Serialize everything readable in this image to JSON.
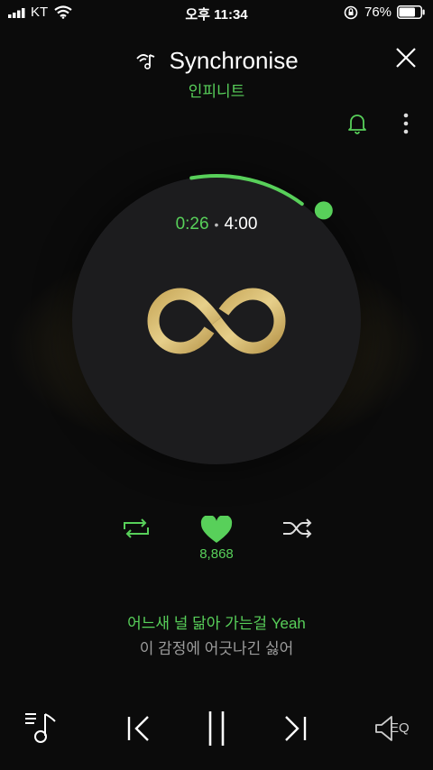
{
  "status_bar": {
    "carrier": "KT",
    "time": "오후 11:34",
    "battery_percent": "76%",
    "battery_level": 0.76
  },
  "header": {
    "song_title": "Synchronise",
    "artist": "인피니트",
    "close_icon": "close-icon",
    "alarm_icon": "bell-icon",
    "more_icon": "more-vertical-icon"
  },
  "player": {
    "current_time": "0:26",
    "separator": "•",
    "total_time": "4:00",
    "progress": 0.108,
    "accent_color": "#58d05a",
    "logo_color": "#d9bd6e"
  },
  "controls": {
    "repeat_icon": "repeat-icon",
    "like_icon": "heart-icon",
    "like_count": "8,868",
    "shuffle_icon": "shuffle-icon"
  },
  "lyrics": {
    "current_line": "어느새 널 닮아 가는걸 Yeah",
    "next_line": "이 감정에 어긋나긴 싫어"
  },
  "bottom_bar": {
    "playlist_icon": "playlist-icon",
    "prev_icon": "previous-icon",
    "pause_icon": "pause-icon",
    "next_icon": "next-icon",
    "eq_label": "EQ"
  }
}
